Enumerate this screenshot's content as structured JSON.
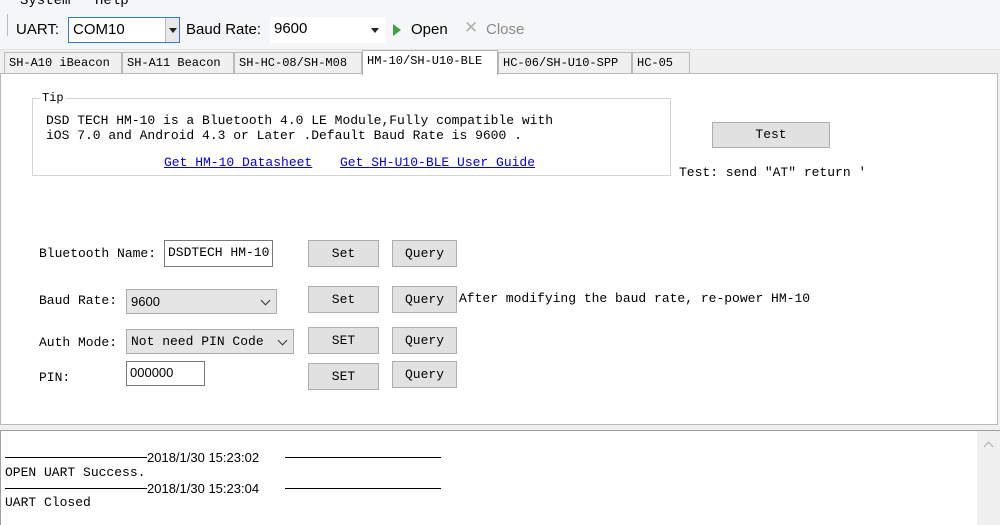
{
  "menu": {
    "items": [
      "System",
      "Help"
    ]
  },
  "toolbar": {
    "uart_label": "UART:",
    "port_value": "COM10",
    "baud_label": "Baud Rate:",
    "baud_value": "9600",
    "open_label": "Open",
    "close_label": "Close"
  },
  "tabs": [
    {
      "label": "SH-A10 iBeacon",
      "active": false
    },
    {
      "label": "SH-A11 Beacon",
      "active": false
    },
    {
      "label": "SH-HC-08/SH-M08",
      "active": false
    },
    {
      "label": "HM-10/SH-U10-BLE",
      "active": true
    },
    {
      "label": "HC-06/SH-U10-SPP",
      "active": false
    },
    {
      "label": "HC-05",
      "active": false
    }
  ],
  "tip": {
    "title": "Tip",
    "text": "DSD TECH HM-10 is a Bluetooth 4.0 LE Module,Fully compatible with\niOS 7.0 and Android 4.3 or Later .Default Baud Rate is 9600 .",
    "datasheet_link": "Get HM-10 Datasheet",
    "guide_link": "Get SH-U10-BLE User Guide"
  },
  "test": {
    "button_label": "Test",
    "hint": "Test: send \"AT\" return '"
  },
  "form": {
    "bt_name_label": "Bluetooth Name:",
    "bt_name_value": "DSDTECH HM-10",
    "bt_set": "Set",
    "bt_query": "Query",
    "baud_label": "Baud Rate:",
    "baud_value": "9600",
    "baud_set": "Set",
    "baud_query": "Query",
    "baud_note": "After modifying the baud rate, re-power HM-10",
    "auth_label": "Auth Mode:",
    "auth_value": "Not need PIN Code",
    "auth_set": "SET",
    "auth_query": "Query",
    "pin_label": "PIN:",
    "pin_value": "000000",
    "pin_set": "SET",
    "pin_query": "Query"
  },
  "log": {
    "ts1": "2018/1/30 15:23:02",
    "line1": "OPEN UART Success.",
    "ts2": "2018/1/30 15:23:04",
    "line2": "UART Closed"
  }
}
